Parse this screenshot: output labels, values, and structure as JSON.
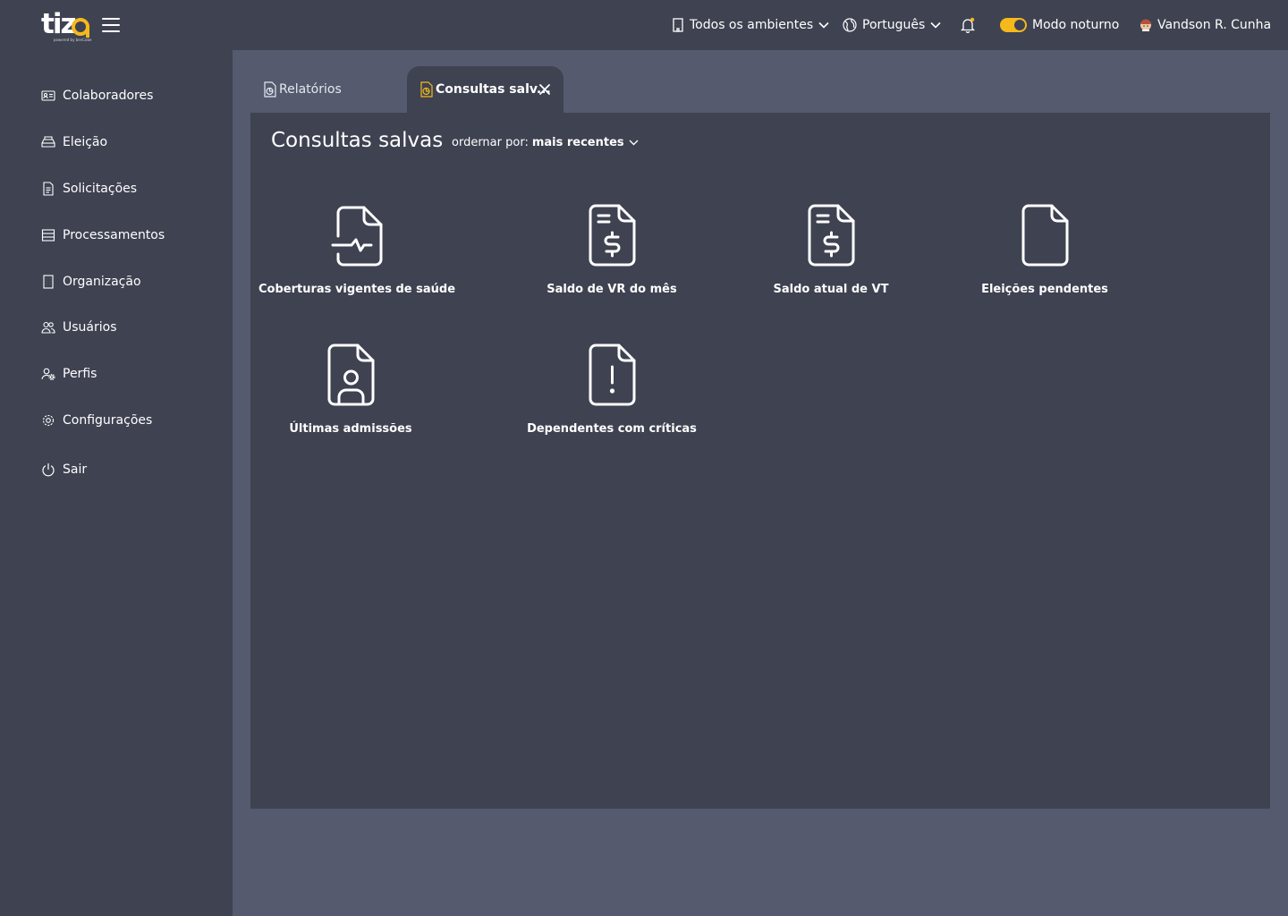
{
  "brand": {
    "name": "tiz",
    "tagline": "powered by benCobe",
    "accent": "#f5b91c"
  },
  "topbar": {
    "environment": {
      "label": "Todos os ambientes",
      "icon": "building-icon"
    },
    "language": {
      "label": "Português",
      "icon": "globe-icon"
    },
    "notifications": {
      "icon": "bell-icon"
    },
    "night_mode": {
      "label": "Modo noturno",
      "enabled": true
    },
    "user": {
      "name": "Vandson R. Cunha",
      "icon": "avatar-icon"
    }
  },
  "sidebar": {
    "items": [
      {
        "label": "Colaboradores",
        "icon": "id-card-icon"
      },
      {
        "label": "Eleição",
        "icon": "tray-icon"
      },
      {
        "label": "Solicitações",
        "icon": "document-icon"
      },
      {
        "label": "Processamentos",
        "icon": "list-icon"
      },
      {
        "label": "Organização",
        "icon": "building-icon"
      },
      {
        "label": "Usuários",
        "icon": "users-icon"
      },
      {
        "label": "Perfis",
        "icon": "user-gear-icon"
      },
      {
        "label": "Configurações",
        "icon": "gear-icon"
      },
      {
        "label": "Sair",
        "icon": "power-icon"
      }
    ]
  },
  "tabs": [
    {
      "label": "Relatórios",
      "active": false,
      "icon": "report-icon"
    },
    {
      "label": "Consultas salv...",
      "active": true,
      "icon": "report-icon",
      "closable": true
    }
  ],
  "panel": {
    "title": "Consultas salvas",
    "sort_label": "ordernar por:",
    "sort_value": "mais recentes",
    "queries": [
      {
        "label": "Coberturas vigentes de saúde",
        "icon": "health-document-icon"
      },
      {
        "label": "Saldo de VR do mês",
        "icon": "money-document-icon"
      },
      {
        "label": "Saldo atual de VT",
        "icon": "money-document-icon"
      },
      {
        "label": "Eleições pendentes",
        "icon": "blank-document-icon"
      },
      {
        "label": "Últimas admissões",
        "icon": "person-document-icon"
      },
      {
        "label": "Dependentes com críticas",
        "icon": "alert-document-icon"
      }
    ]
  }
}
